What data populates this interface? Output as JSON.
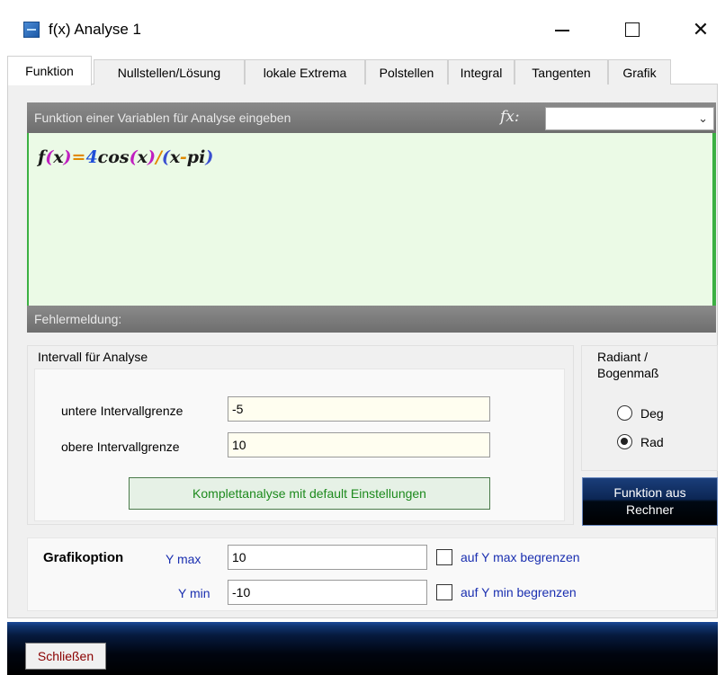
{
  "window": {
    "title": "f(x) Analyse 1",
    "icon": "function-app-icon"
  },
  "tabs": [
    {
      "label": "Funktion",
      "active": true
    },
    {
      "label": "Nullstellen/Lösung",
      "active": false
    },
    {
      "label": "lokale Extrema",
      "active": false
    },
    {
      "label": "Polstellen",
      "active": false
    },
    {
      "label": "Integral",
      "active": false
    },
    {
      "label": "Tangenten",
      "active": false
    },
    {
      "label": "Grafik",
      "active": false
    }
  ],
  "function_panel": {
    "header": "Funktion einer Variablen für Analyse eingeben",
    "fx_label": "fx:",
    "fx_select_value": "",
    "formula_parts": [
      {
        "text": "f",
        "color": "#1a1a1a"
      },
      {
        "text": "(",
        "color": "#c020c0"
      },
      {
        "text": "x",
        "color": "#1a1a1a"
      },
      {
        "text": ")",
        "color": "#c020c0"
      },
      {
        "text": "=",
        "color": "#e08a00"
      },
      {
        "text": "4",
        "color": "#1f4fd8"
      },
      {
        "text": "cos",
        "color": "#1a1a1a"
      },
      {
        "text": "(",
        "color": "#c020c0"
      },
      {
        "text": "x",
        "color": "#1a1a1a"
      },
      {
        "text": ")",
        "color": "#c020c0"
      },
      {
        "text": "/",
        "color": "#e08a00"
      },
      {
        "text": "(",
        "color": "#3a4fd0"
      },
      {
        "text": "x",
        "color": "#1a1a1a"
      },
      {
        "text": "-",
        "color": "#e08a00"
      },
      {
        "text": "pi",
        "color": "#1a1a1a"
      },
      {
        "text": ")",
        "color": "#3a4fd0"
      }
    ],
    "error_label": "Fehlermeldung:"
  },
  "interval": {
    "group_title": "Intervall für Analyse",
    "lower_label": "untere Intervallgrenze",
    "lower_value": "-5",
    "upper_label": "obere Intervallgrenze",
    "upper_value": "10",
    "full_analysis_button": "Komplettanalyse mit default Einstellungen"
  },
  "angle_mode": {
    "group_title_line1": "Radiant /",
    "group_title_line2": "Bogenmaß",
    "options": [
      {
        "label": "Deg",
        "selected": false
      },
      {
        "label": "Rad",
        "selected": true
      }
    ]
  },
  "calculator_button": {
    "line1": "Funktion aus",
    "line2": "Rechner"
  },
  "graphic_options": {
    "title": "Grafikoption",
    "ymax_label": "Y max",
    "ymax_value": "10",
    "ymax_check_label": "auf Y max begrenzen",
    "ymax_checked": false,
    "ymin_label": "Y min",
    "ymin_value": "-10",
    "ymin_check_label": "auf Y min begrenzen",
    "ymin_checked": false
  },
  "footer": {
    "close_button": "Schließen"
  },
  "colors": {
    "header_gray": "#7a7a7a",
    "formula_bg": "#ebfae6",
    "accent_green": "#3cb043",
    "label_blue": "#1a2fb0",
    "close_text": "#8a0000"
  }
}
